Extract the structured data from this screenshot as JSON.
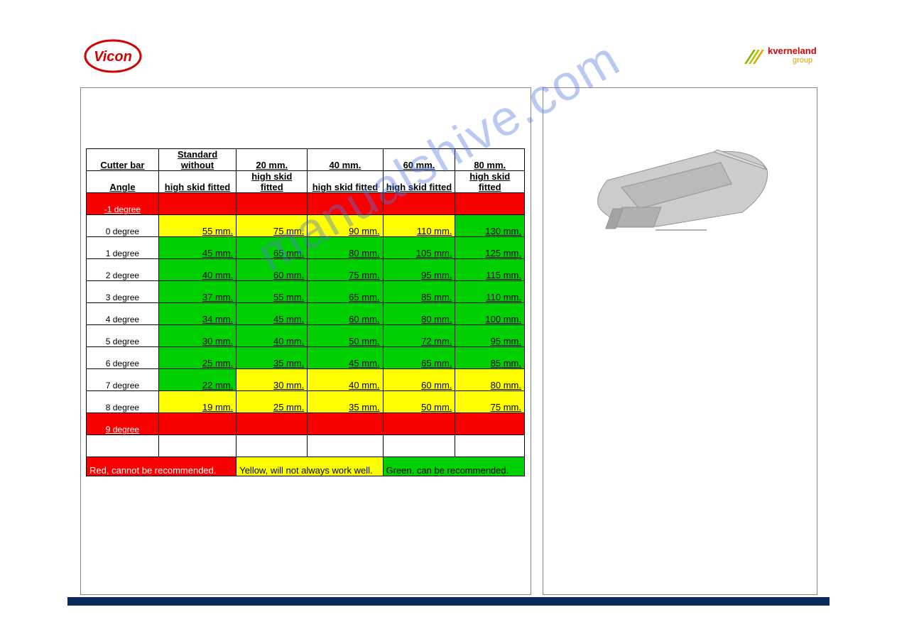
{
  "logos": {
    "left_text": "Vicon",
    "right_top": "kverneland",
    "right_sub": "group"
  },
  "watermark": "manualshive.com",
  "table": {
    "header1": [
      "Cutter bar",
      "Standard without",
      "20 mm.",
      "40 mm.",
      "60 mm.",
      "80 mm."
    ],
    "header2": [
      "Angle",
      "high skid fitted",
      "high skid fitted",
      "high skid fitted",
      "high skid fitted",
      "high skid fitted"
    ],
    "rows": [
      {
        "angle": "-1 degree",
        "cells": [
          "",
          "",
          "",
          "",
          ""
        ],
        "rowcolor": "red"
      },
      {
        "angle": "0 degree",
        "cells": [
          "55 mm.",
          "75 mm.",
          "90 mm.",
          "110 mm.",
          "130 mm."
        ],
        "colors": [
          "yellow",
          "yellow",
          "yellow",
          "yellow",
          "green"
        ]
      },
      {
        "angle": "1 degree",
        "cells": [
          "45 mm.",
          "65 mm.",
          "80 mm.",
          "105 mm.",
          "125 mm."
        ],
        "colors": [
          "green",
          "green",
          "green",
          "green",
          "green"
        ]
      },
      {
        "angle": "2 degree",
        "cells": [
          "40 mm.",
          "60 mm.",
          "75 mm.",
          "95 mm.",
          "115 mm."
        ],
        "colors": [
          "green",
          "green",
          "green",
          "green",
          "green"
        ]
      },
      {
        "angle": "3 degree",
        "cells": [
          "37 mm.",
          "55 mm.",
          "65 mm.",
          "85 mm.",
          "110 mm."
        ],
        "colors": [
          "green",
          "green",
          "green",
          "green",
          "green"
        ]
      },
      {
        "angle": "4 degree",
        "cells": [
          "34 mm.",
          "45 mm.",
          "60 mm.",
          "80 mm.",
          "100 mm."
        ],
        "colors": [
          "green",
          "green",
          "green",
          "green",
          "green"
        ]
      },
      {
        "angle": "5 degree",
        "cells": [
          "30 mm.",
          "40 mm.",
          "50 mm.",
          "72 mm.",
          "95 mm."
        ],
        "colors": [
          "green",
          "green",
          "green",
          "green",
          "green"
        ]
      },
      {
        "angle": "6 degree",
        "cells": [
          "25 mm.",
          "35 mm.",
          "45 mm.",
          "65 mm.",
          "85 mm."
        ],
        "colors": [
          "green",
          "green",
          "green",
          "green",
          "green"
        ]
      },
      {
        "angle": "7 degree",
        "cells": [
          "22 mm.",
          "30 mm.",
          "40 mm.",
          "60 mm.",
          "80 mm."
        ],
        "colors": [
          "green",
          "yellow",
          "yellow",
          "yellow",
          "yellow"
        ]
      },
      {
        "angle": "8 degree",
        "cells": [
          "19 mm.",
          "25 mm.",
          "35 mm.",
          "50 mm.",
          "75 mm."
        ],
        "colors": [
          "yellow",
          "yellow",
          "yellow",
          "yellow",
          "yellow"
        ]
      },
      {
        "angle": "9 degree",
        "cells": [
          "",
          "",
          "",
          "",
          ""
        ],
        "rowcolor": "red"
      }
    ],
    "legend": {
      "red": "Red, cannot be    recommended.",
      "yellow": "Yellow, will not always work well.",
      "green": "Green, can be recommended."
    }
  }
}
